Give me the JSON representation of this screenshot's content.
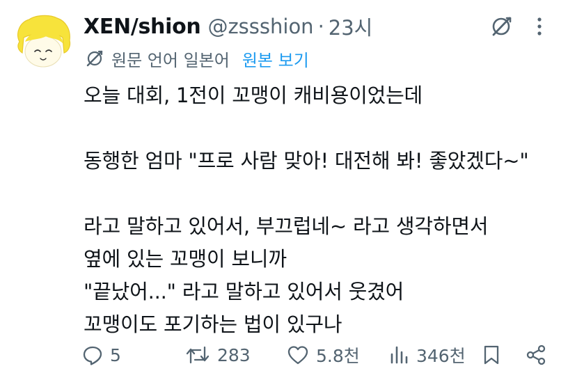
{
  "tweet": {
    "author_name": "XEN/shion",
    "handle": "@zssshion",
    "separator": "·",
    "time": "23시",
    "translation_label": "원문 언어 일본어",
    "show_original": "원본 보기",
    "text": "오늘 대회, 1전이 꼬맹이 캐비용이었는데\n\n동행한 엄마 \"프로 사람 맞아! 대전해 봐! 좋았겠다~\"\n\n라고 말하고 있어서, 부끄럽네~ 라고 생각하면서\n옆에 있는 꼬맹이 보니까\n\"끝났어...\" 라고 말하고 있어서 웃겼어\n꼬맹이도 포기하는 법이 있구나"
  },
  "actions": {
    "replies": "5",
    "reposts": "283",
    "likes": "5.8천",
    "views": "346천"
  },
  "colors": {
    "text": "#0f1419",
    "secondary": "#536471",
    "link": "#1d9bf0",
    "avatar_hair": "#f7e33b"
  },
  "icons": [
    "avatar",
    "grok-icon",
    "more-vertical-icon",
    "translate-icon",
    "reply-icon",
    "repost-icon",
    "like-icon",
    "views-icon",
    "bookmark-icon",
    "share-icon"
  ]
}
